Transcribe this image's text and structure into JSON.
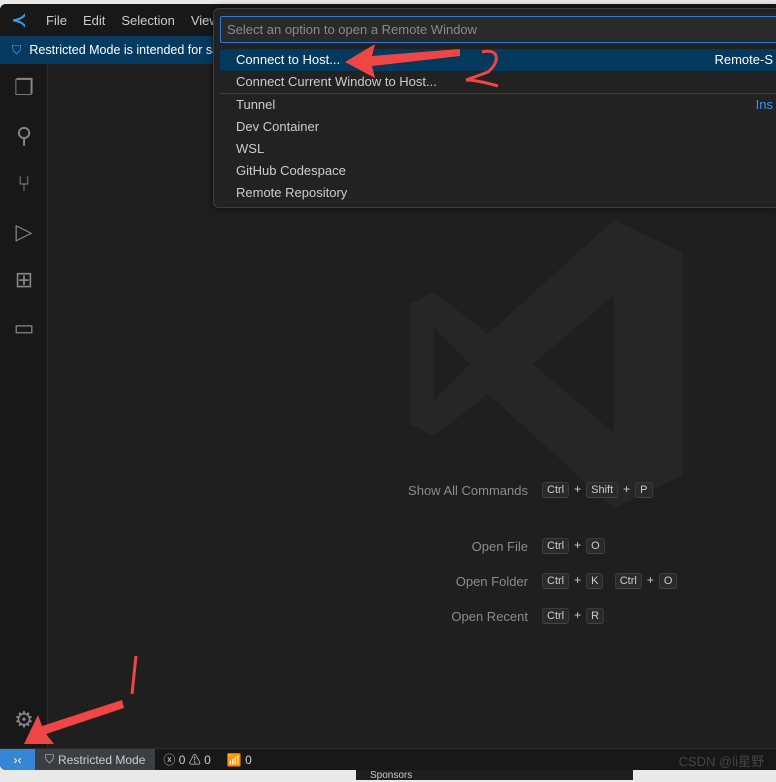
{
  "titlebar": {
    "menus": [
      "File",
      "Edit",
      "Selection",
      "View"
    ]
  },
  "banner": {
    "text": "Restricted Mode is intended for sa"
  },
  "quickpick": {
    "placeholder": "Select an option to open a Remote Window",
    "items": [
      {
        "label": "Connect to Host...",
        "detail": "Remote-S"
      },
      {
        "label": "Connect Current Window to Host..."
      },
      {
        "label": "Tunnel",
        "detail": "Ins"
      },
      {
        "label": "Dev Container"
      },
      {
        "label": "WSL"
      },
      {
        "label": "GitHub Codespace"
      },
      {
        "label": "Remote Repository"
      }
    ]
  },
  "shortcuts": [
    {
      "label": "Show All Commands",
      "keys": [
        "Ctrl",
        "+",
        "Shift",
        "+",
        "P"
      ]
    },
    {
      "label": "Open File",
      "keys": [
        "Ctrl",
        "+",
        "O"
      ]
    },
    {
      "label": "Open Folder",
      "keys": [
        "Ctrl",
        "+",
        "K",
        "Ctrl",
        "+",
        "O"
      ]
    },
    {
      "label": "Open Recent",
      "keys": [
        "Ctrl",
        "+",
        "R"
      ]
    }
  ],
  "status": {
    "restricted": "Restricted Mode",
    "errors": "0",
    "warnings": "0",
    "ports": "0"
  },
  "annotations": {
    "one": "1",
    "two": "2"
  },
  "watermark": "CSDN @li星野",
  "background": {
    "sponsors": "Sponsors"
  },
  "colors": {
    "accent": "#3587d6",
    "selection": "#04395e",
    "banner": "#063b5f",
    "annotation": "#f04545"
  }
}
